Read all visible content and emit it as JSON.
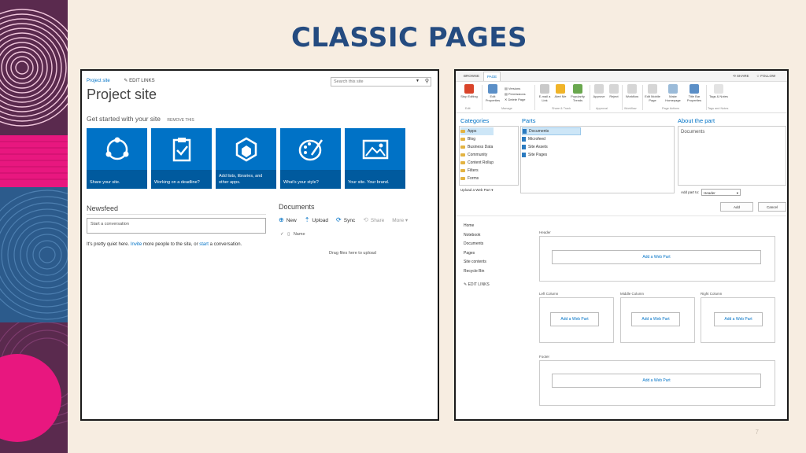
{
  "slide": {
    "title": "CLASSIC PAGES",
    "number": "7"
  },
  "left_panel": {
    "site_link": "Project site",
    "edit_links": "EDIT LINKS",
    "search_placeholder": "Search this site",
    "site_title": "Project site",
    "get_started": "Get started with your site",
    "remove_this": "REMOVE THIS",
    "tiles": [
      {
        "icon": "share-icon",
        "caption": "Share your site."
      },
      {
        "icon": "clipboard-icon",
        "caption": "Working on a deadline?"
      },
      {
        "icon": "apps-icon",
        "caption": "Add lists, libraries, and other apps."
      },
      {
        "icon": "palette-icon",
        "caption": "What's your style?"
      },
      {
        "icon": "image-icon",
        "caption": "Your site. Your brand."
      }
    ],
    "newsfeed": "Newsfeed",
    "conversation_placeholder": "Start a conversation",
    "quiet_text_1": "It's pretty quiet here. ",
    "invite": "Invite",
    "quiet_text_2": " more people to the site, or ",
    "start": "start",
    "quiet_text_3": " a conversation.",
    "documents": "Documents",
    "doc_actions": [
      "New",
      "Upload",
      "Sync",
      "Share",
      "More"
    ],
    "name_header": "Name",
    "drag_text": "Drag files here to upload"
  },
  "right_panel": {
    "tabs": [
      "BROWSE",
      "PAGE"
    ],
    "top_right": [
      "SHARE",
      "FOLLOW"
    ],
    "ribbon_buttons": [
      "Stop Editing",
      "Edit Properties",
      "Versions",
      "Permissions",
      "Delete Page",
      "E-mail a Link",
      "Alert Me",
      "Popularity Trends",
      "Approve",
      "Reject",
      "Workflow",
      "Edit Mobile Page",
      "Make Homepage",
      "Title Bar Properties",
      "Tags & Notes"
    ],
    "ribbon_groups": [
      "Edit",
      "Manage",
      "Share & Track",
      "Approval",
      "Workflow",
      "Page Actions",
      "Tags and Notes"
    ],
    "categories_title": "Categories",
    "parts_title": "Parts",
    "about_title": "About the part",
    "categories": [
      "Apps",
      "Blog",
      "Business Data",
      "Community",
      "Content Rollup",
      "Filters",
      "Forms"
    ],
    "parts": [
      "Documents",
      "Microfeed",
      "Site Assets",
      "Site Pages"
    ],
    "about_text": "Documents",
    "upload_web_part": "Upload a Web Part",
    "add_part_to": "Add part to:",
    "add_part_value": "Header",
    "add_btn": "Add",
    "cancel_btn": "Cancel",
    "nav": [
      "Home",
      "Notebook",
      "Documents",
      "Pages",
      "Site contents",
      "Recycle Bin"
    ],
    "edit_links": "EDIT LINKS",
    "zones": {
      "header": "Header",
      "left": "Left Column",
      "middle": "Middle Column",
      "right": "Right Column",
      "footer": "Footer"
    },
    "add_web_part": "Add a Web Part"
  },
  "colors": {
    "accent": "#244b80",
    "sp_blue": "#0072c6",
    "tile_dark": "#005a9e"
  }
}
